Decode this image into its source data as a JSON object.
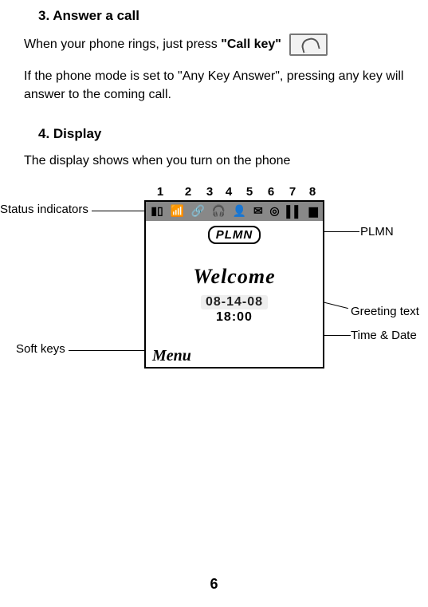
{
  "section3": {
    "heading": "3.  Answer a call",
    "para1_a": "When your phone rings, just press ",
    "para1_b": "\"Call key\"",
    "para2": "If the phone mode is set to \"Any Key Answer\", pressing any key will answer to the coming call."
  },
  "section4": {
    "heading": "4.  Display",
    "para1": "The display shows when you turn on the phone"
  },
  "numbers": [
    "1",
    "2",
    "3",
    "4",
    "5",
    "6",
    "7",
    "8"
  ],
  "labels": {
    "status": "Status indicators",
    "softkeys": "Soft keys",
    "plmn": "PLMN",
    "greeting": "Greeting text",
    "timedate": "Time & Date"
  },
  "screen": {
    "status_icons": [
      "▮▯",
      "📶",
      "🔗",
      "🎧",
      "👤",
      "✉",
      "◎",
      "▌▌",
      "▆"
    ],
    "plmn": "PLMN",
    "greeting": "Welcome",
    "date": "08-14-08",
    "time": "18:00",
    "soft_left": "Menu"
  },
  "page_number": "6"
}
